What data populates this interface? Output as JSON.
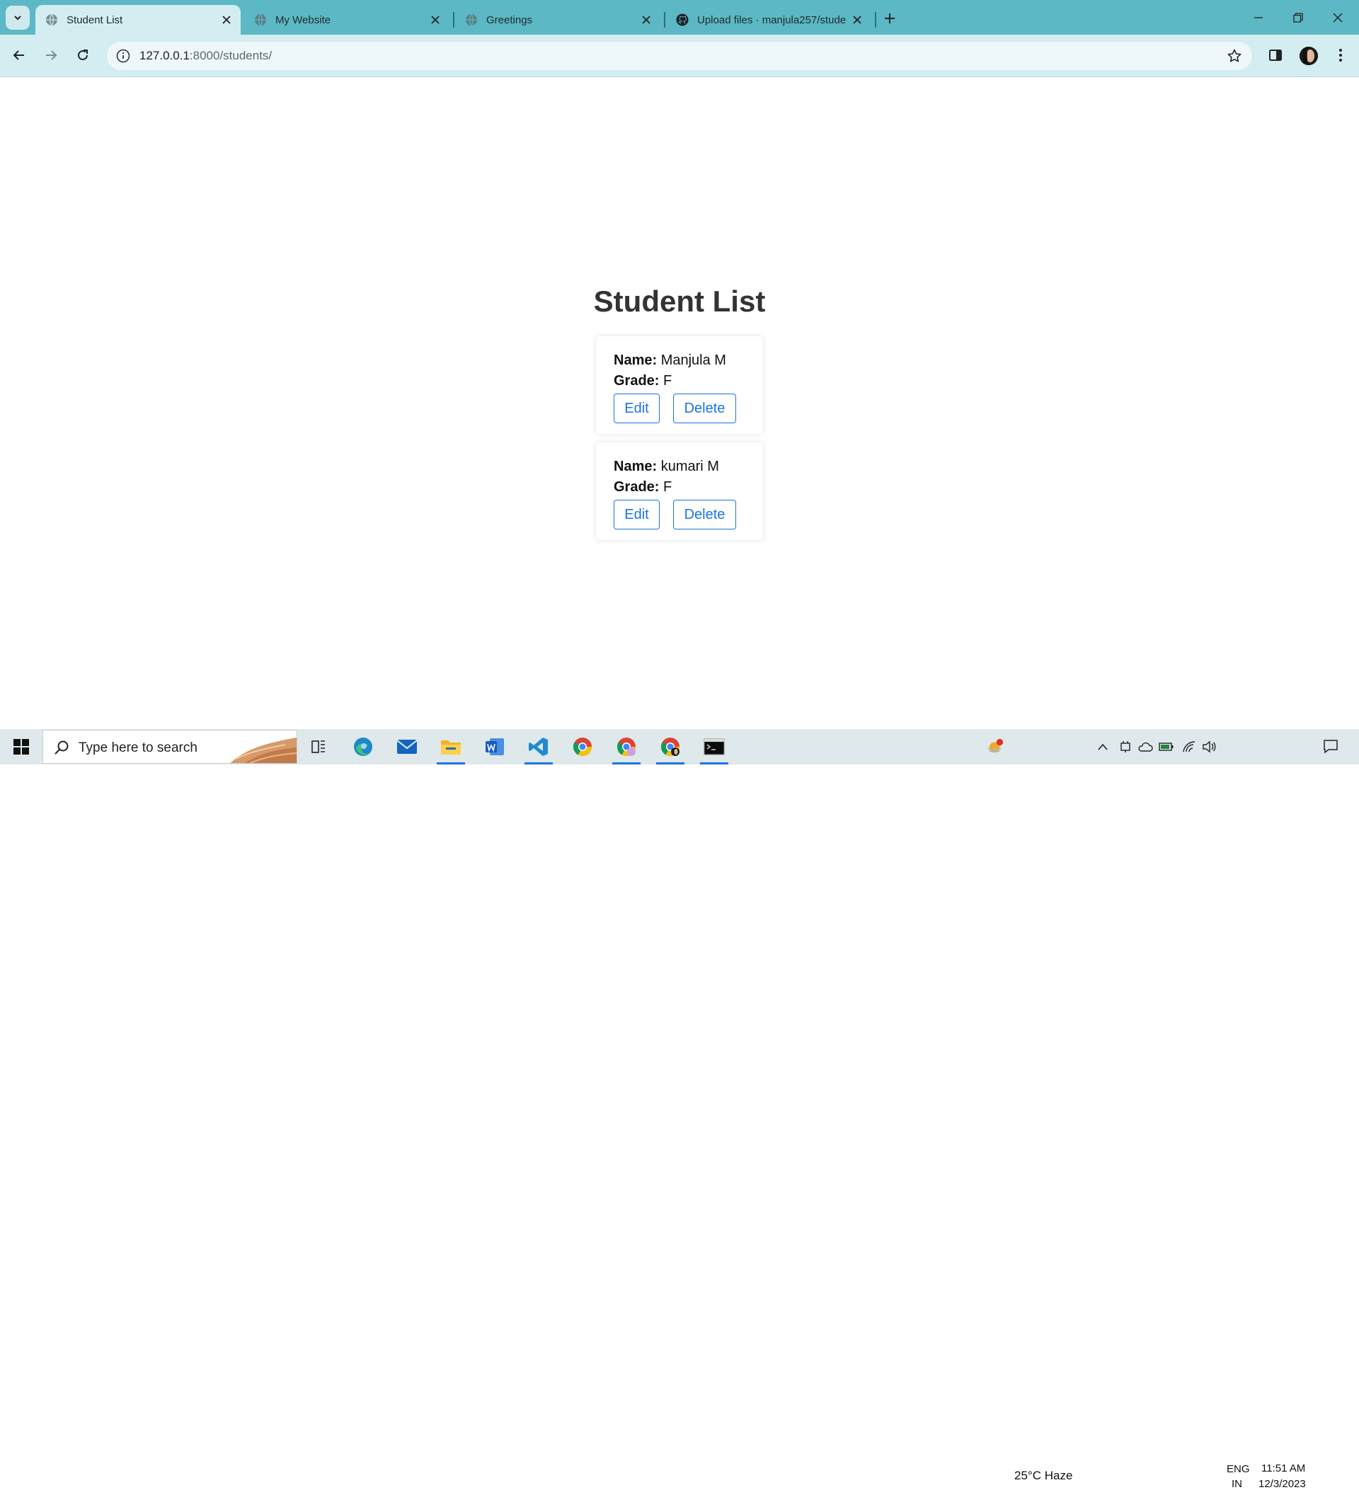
{
  "browser": {
    "tabs": [
      {
        "title": "Student List",
        "active": true
      },
      {
        "title": "My Website",
        "active": false
      },
      {
        "title": "Greetings",
        "active": false
      },
      {
        "title": "Upload files · manjula257/stude",
        "active": false
      }
    ],
    "url_host": "127.0.0.1",
    "url_path": ":8000/students/"
  },
  "page": {
    "heading": "Student List",
    "name_label": "Name:",
    "grade_label": "Grade:",
    "students": [
      {
        "name": "Manjula M",
        "grade": "F",
        "edit_label": "Edit",
        "delete_label": "Delete"
      },
      {
        "name": "kumari M",
        "grade": "F",
        "edit_label": "Edit",
        "delete_label": "Delete"
      }
    ]
  },
  "taskbar": {
    "search_placeholder": "Type here to search",
    "weather": "25°C  Haze",
    "weather_badge": "1",
    "language_top": "ENG",
    "language_bottom": "IN",
    "time": "11:51 AM",
    "date": "12/3/2023"
  },
  "colors": {
    "tabbar": "#5bb8c4",
    "toolbar": "#d3edf1",
    "button_accent": "#1a73e8",
    "heading": "#333333"
  }
}
